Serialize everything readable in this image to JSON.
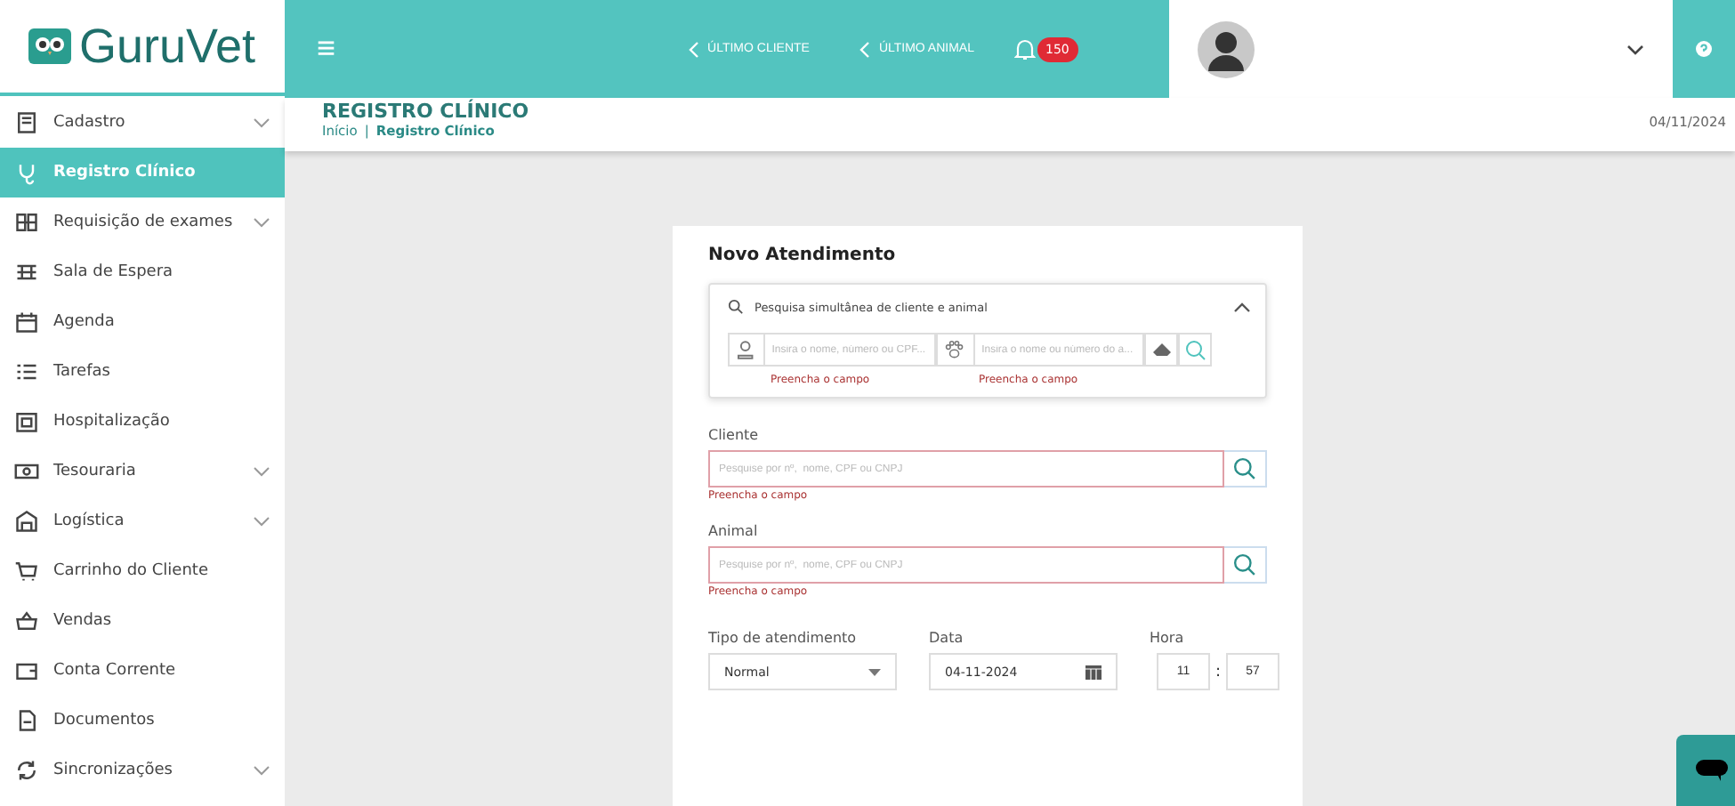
{
  "logo": {
    "text": "GuruVet"
  },
  "header": {
    "menu_icon": "≡",
    "links": [
      {
        "label": "ÚLTIMO CLIENTE"
      },
      {
        "label": "ÚLTIMO ANIMAL"
      }
    ],
    "notifications": {
      "count": "150"
    }
  },
  "sidebar": {
    "items": [
      {
        "label": "Cadastro",
        "selected": false,
        "expandable": true
      },
      {
        "label": "Registro Clínico",
        "selected": true,
        "expandable": false
      },
      {
        "label": "Requisição de exames",
        "selected": false,
        "expandable": true
      },
      {
        "label": "Sala de Espera",
        "selected": false,
        "expandable": false
      },
      {
        "label": "Agenda",
        "selected": false,
        "expandable": false
      },
      {
        "label": "Tarefas",
        "selected": false,
        "expandable": false
      },
      {
        "label": "Hospitalização",
        "selected": false,
        "expandable": false
      },
      {
        "label": "Tesouraria",
        "selected": false,
        "expandable": true
      },
      {
        "label": "Logística",
        "selected": false,
        "expandable": true
      },
      {
        "label": "Carrinho do Cliente",
        "selected": false,
        "expandable": false
      },
      {
        "label": "Vendas",
        "selected": false,
        "expandable": false
      },
      {
        "label": "Conta Corrente",
        "selected": false,
        "expandable": false
      },
      {
        "label": "Documentos",
        "selected": false,
        "expandable": false
      },
      {
        "label": "Sincronizações",
        "selected": false,
        "expandable": true
      }
    ]
  },
  "page": {
    "title": "REGISTRO CLÍNICO",
    "breadcrumb": [
      "Início",
      "Registro Clínico"
    ],
    "breadcrumb_separator": "|",
    "date": "04/11/2024"
  },
  "form": {
    "title": "Novo Atendimento",
    "quick_search": {
      "title": "Pesquisa simultânea de cliente e animal",
      "expanded": true,
      "fields": [
        {
          "placeholder": "Insira o nome, número ou CPF...",
          "error": "Preencha o campo"
        },
        {
          "placeholder": "Insira o nome ou número do a...",
          "error": "Preencha o campo"
        }
      ]
    },
    "fields": [
      {
        "label": "Cliente",
        "placeholder": "Pesquise por nº,  nome, CPF ou CNPJ",
        "error": "Preencha o campo"
      },
      {
        "label": "Animal",
        "placeholder": "Pesquise por nº,  nome, CPF ou CNPJ",
        "error": "Preencha o campo"
      }
    ],
    "tipo": {
      "label": "Tipo de atendimento",
      "value": "Normal"
    },
    "data": {
      "label": "Data",
      "value": "04-11-2024"
    },
    "hora": {
      "label": "Hora",
      "hour": "11",
      "separator": ":",
      "minute": "57"
    }
  }
}
